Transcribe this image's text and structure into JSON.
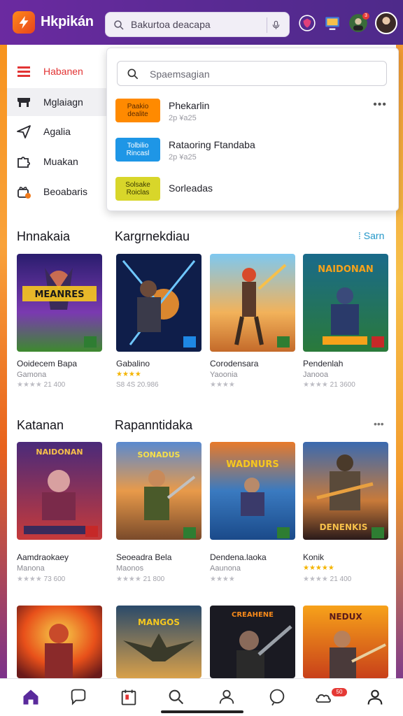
{
  "header": {
    "brand": "Hkpikán",
    "search_text": "Bakurtoa deacapa",
    "notification_badge": "3"
  },
  "sidebar": {
    "items": [
      {
        "label": "Habanen",
        "icon": "hamburger-icon",
        "active": false,
        "highlight": true
      },
      {
        "label": "Mglaiagn",
        "icon": "store-icon",
        "active": true,
        "highlight": false
      },
      {
        "label": "Agalia",
        "icon": "send-icon",
        "active": false,
        "highlight": false
      },
      {
        "label": "Muakan",
        "icon": "puzzle-icon",
        "active": false,
        "highlight": false
      },
      {
        "label": "Beoabaris",
        "icon": "gift-icon",
        "active": false,
        "highlight": false
      }
    ]
  },
  "dropdown": {
    "search_placeholder": "Spaemsagian",
    "more_label": "•••",
    "items": [
      {
        "tag_line1": "Paakio",
        "tag_line2": "dealite",
        "tag_color": "#ff8a00",
        "title": "Phekarlin",
        "sub": "2p ¥a25"
      },
      {
        "tag_line1": "Tolbilio",
        "tag_line2": "Rincasl",
        "tag_color": "#1e96e6",
        "title": "Rataoring Ftandaba",
        "sub": "2p ¥a25"
      },
      {
        "tag_line1": "Solsake",
        "tag_line2": "Roiclas",
        "tag_color": "#d8d62a",
        "title": "Sorleadas",
        "sub": ""
      }
    ]
  },
  "sections": [
    {
      "left_title": "Hnnakaia",
      "right_title": "Kargrnekdiau",
      "link": "Sarn"
    },
    {
      "left_title": "Katanan",
      "right_title": "Rapanntidaka",
      "link": "•••"
    }
  ],
  "rows": [
    [
      {
        "title": "Ooidecem Bapa",
        "sub": "Gamona",
        "meta": "21 400",
        "gold": false,
        "art": "MEANRES"
      },
      {
        "title": "Gabalino",
        "sub": "",
        "meta": "S8 4S 20.986",
        "gold": true,
        "art": ""
      },
      {
        "title": "Corodensara",
        "sub": "Yaoonia",
        "meta": "",
        "gold": false,
        "art": ""
      },
      {
        "title": "Pendenlah",
        "sub": "Janooa",
        "meta": "21 3600",
        "gold": false,
        "art": "NAIDONAN"
      }
    ],
    [
      {
        "title": "Aamdraokaey",
        "sub": "Manona",
        "meta": "73 600",
        "gold": false,
        "art": "NAIDONAN"
      },
      {
        "title": "Seoeadra Bela",
        "sub": "Maonos",
        "meta": "21 800",
        "gold": false,
        "art": "SONADUS"
      },
      {
        "title": "Dendena.laoka",
        "sub": "Aaunona",
        "meta": "",
        "gold": false,
        "art": "WADNURS"
      },
      {
        "title": "Konik",
        "sub": "",
        "meta": "21 400",
        "gold": true,
        "art": "DENENKIS"
      }
    ],
    [
      {
        "title": "",
        "sub": "",
        "meta": "",
        "gold": false,
        "art": ""
      },
      {
        "title": "",
        "sub": "",
        "meta": "",
        "gold": false,
        "art": "MANGOS"
      },
      {
        "title": "",
        "sub": "",
        "meta": "",
        "gold": false,
        "art": "CREAHENE"
      },
      {
        "title": "",
        "sub": "",
        "meta": "",
        "gold": false,
        "art": "NEDUX"
      }
    ]
  ],
  "bottom_nav": {
    "items": [
      "home-icon",
      "chat-icon",
      "calendar-icon",
      "search-icon",
      "people-icon",
      "chat-circle-icon",
      "cloud-icon",
      "profile-icon"
    ],
    "badge": "50"
  }
}
